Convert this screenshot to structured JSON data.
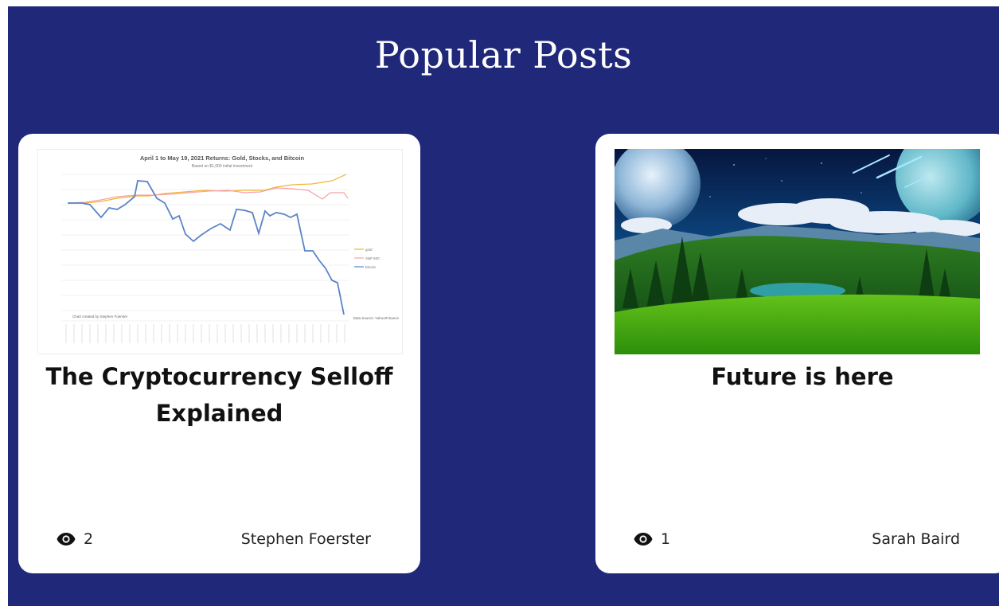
{
  "section": {
    "title": "Popular Posts"
  },
  "posts": [
    {
      "title": "The Cryptocurrency Selloff Explained",
      "views": "2",
      "author": "Stephen Foerster",
      "image": {
        "kind": "line-chart-thumbnail",
        "chart_title": "April 1 to May 19, 2021 Returns: Gold, Stocks, and Bitcoin",
        "chart_subtitle": "Based on $1,000 initial investment",
        "legend": [
          "gold",
          "S&P 500",
          "bitcoin"
        ],
        "credit_left": "Chart created by Stephen Foerster",
        "credit_right": "Data Source: Yahoo!Finance"
      }
    },
    {
      "title": "Future is here",
      "views": "1",
      "author": "Sarah Baird",
      "image": {
        "kind": "fantasy-landscape-photo"
      }
    }
  ],
  "icons": {
    "views": "eye-icon"
  },
  "colors": {
    "background": "#20287a",
    "card": "#ffffff",
    "text": "#111111"
  }
}
